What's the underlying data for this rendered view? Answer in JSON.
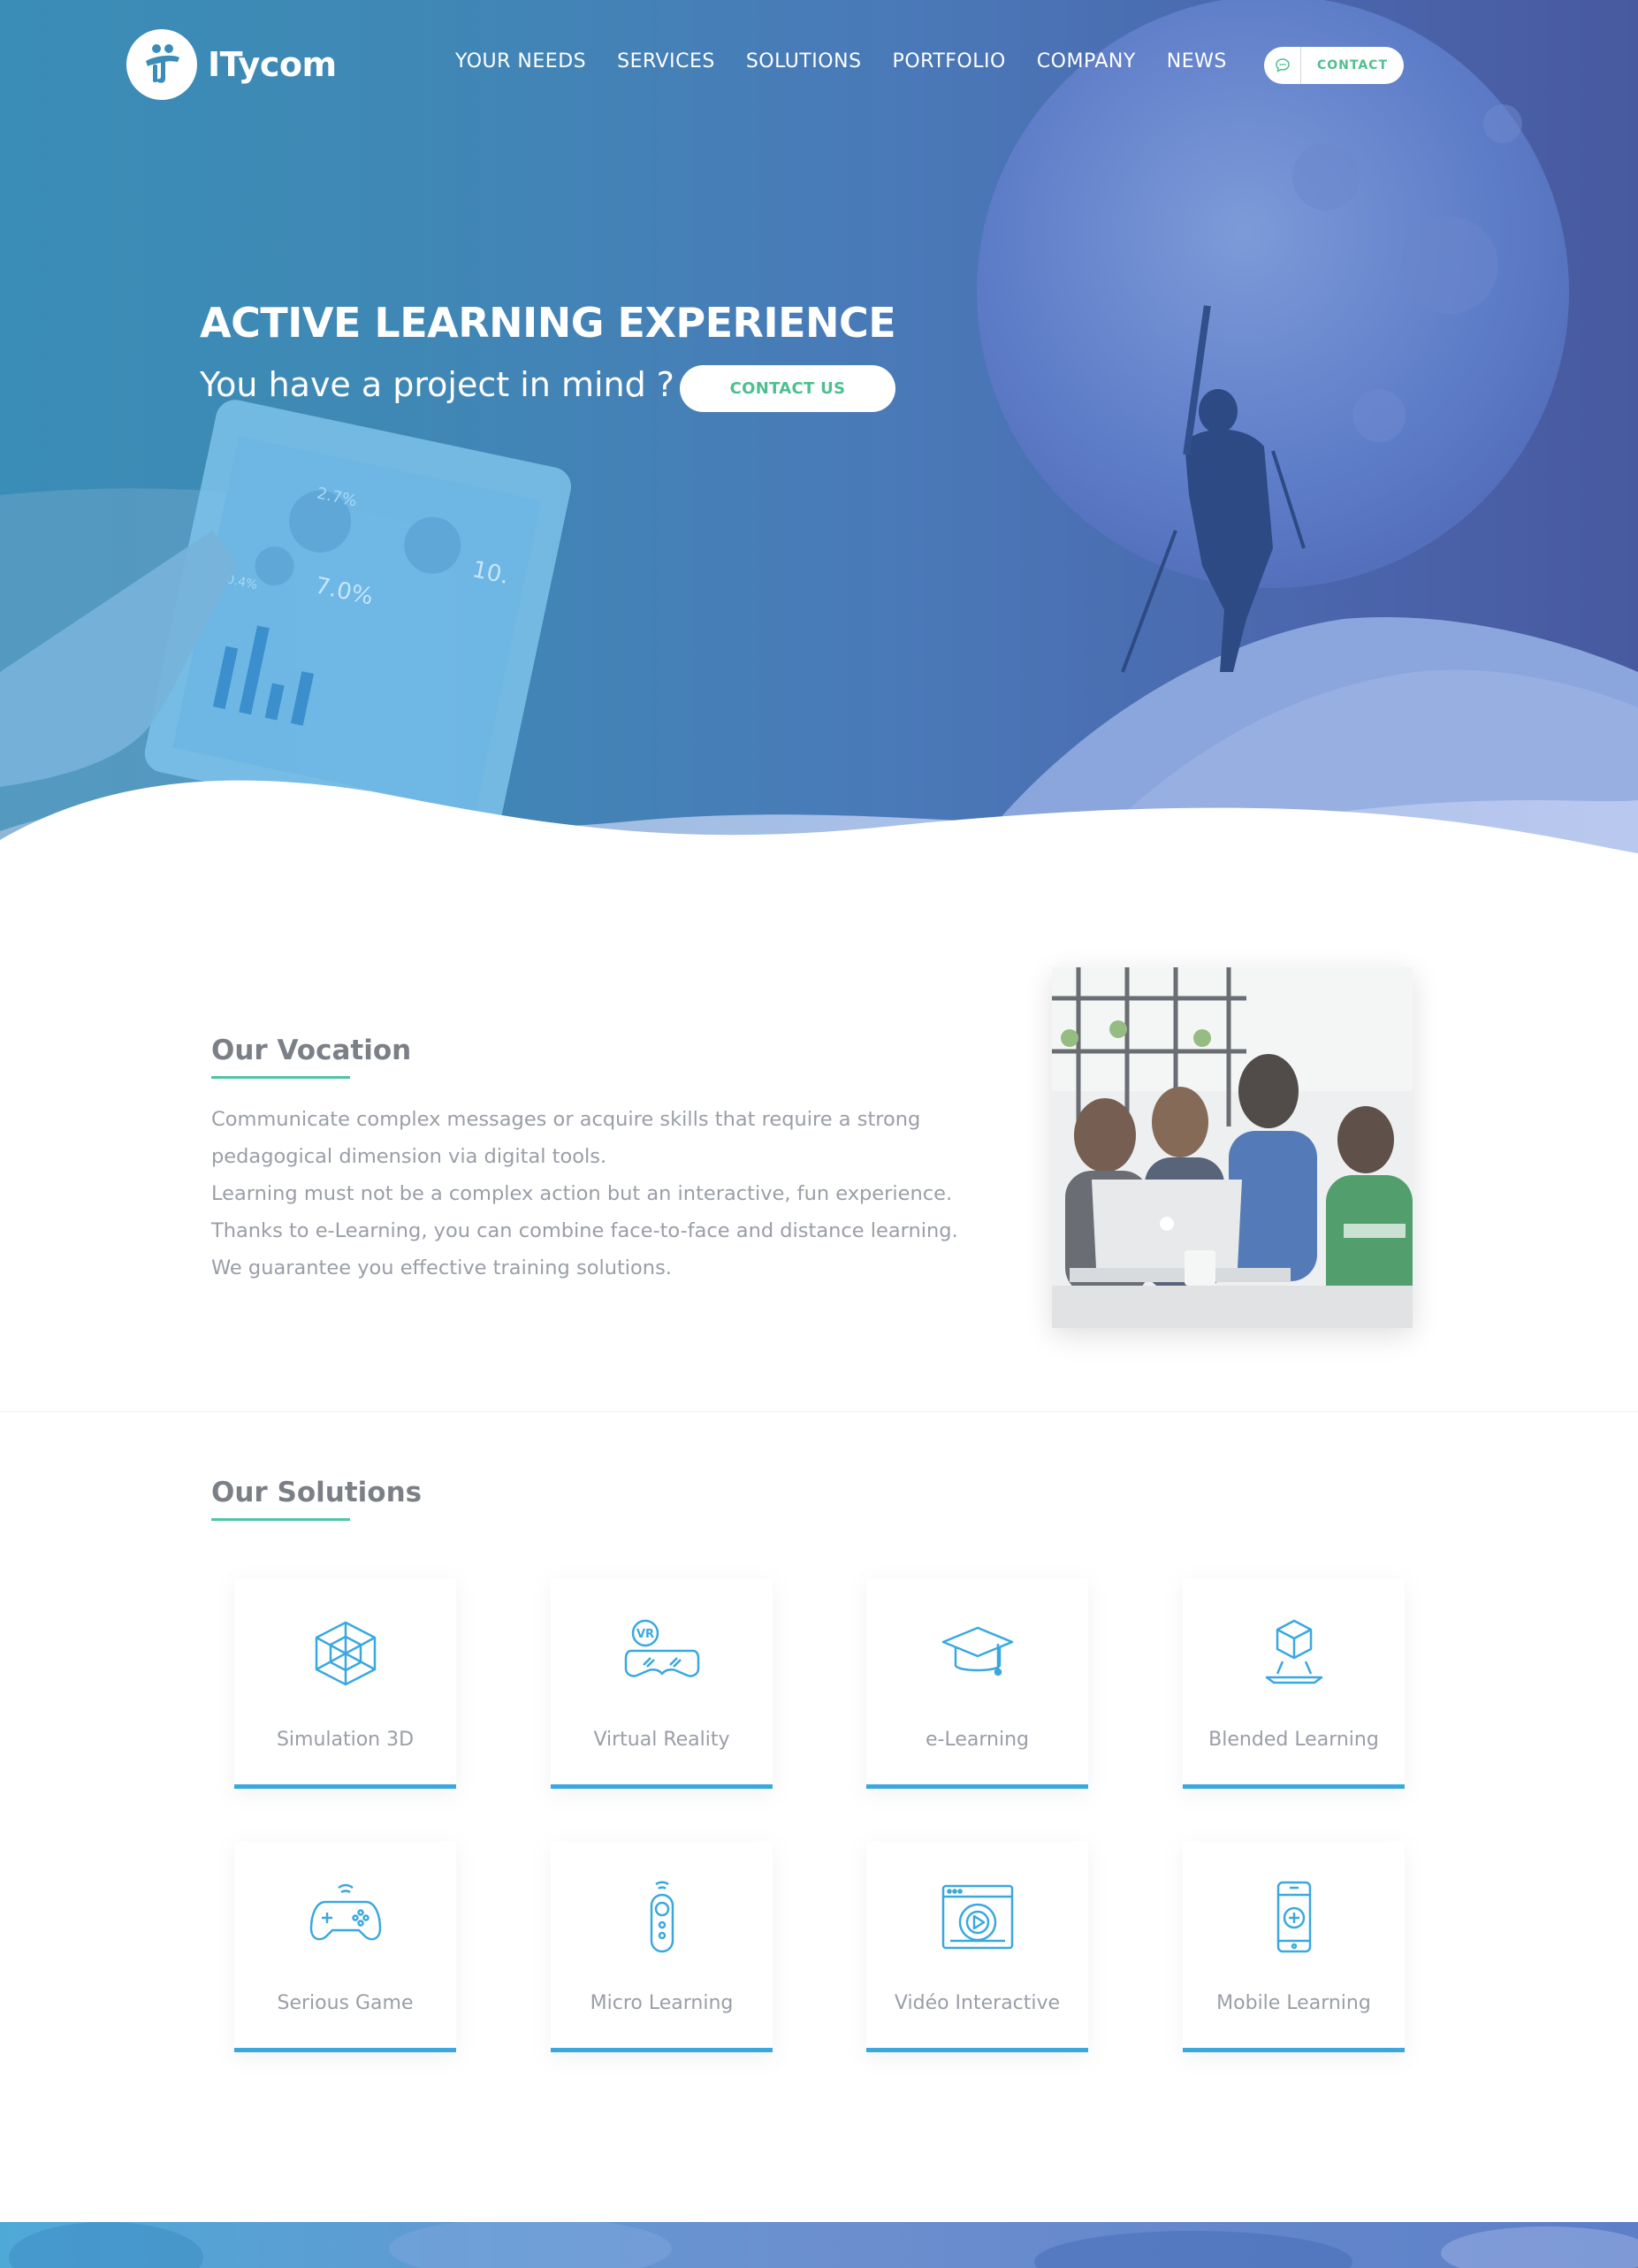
{
  "header": {
    "logo_text": "ITycom",
    "menu": [
      "YOUR NEEDS",
      "SERVICES",
      "SOLUTIONS",
      "PORTFOLIO",
      "COMPANY",
      "NEWS"
    ],
    "contact_label": "CONTACT",
    "contact_icon": "chat-bubble-icon"
  },
  "hero": {
    "title": "ACTIVE LEARNING EXPERIENCE",
    "subtitle": "You have a project in mind ?",
    "cta_label": "CONTACT US",
    "tablet_labels": [
      "2.7%",
      "10.",
      "7.0%",
      "0.4%"
    ]
  },
  "vocation": {
    "title": "Our Vocation",
    "lines": [
      "Communicate complex messages or acquire skills that require a strong",
      "pedagogical dimension via digital tools.",
      "Learning must not be a complex action but an interactive, fun experience.",
      "Thanks to e-Learning, you can combine face-to-face and distance learning.",
      "We guarantee you effective training solutions."
    ]
  },
  "solutions": {
    "title": "Our Solutions",
    "items": [
      {
        "label": "Simulation 3D",
        "icon": "cube-3d-icon"
      },
      {
        "label": "Virtual Reality",
        "icon": "vr-headset-icon"
      },
      {
        "label": "e-Learning",
        "icon": "graduation-cap-icon"
      },
      {
        "label": "Blended Learning",
        "icon": "hologram-cube-icon"
      },
      {
        "label": "Serious Game",
        "icon": "gamepad-icon"
      },
      {
        "label": "Micro Learning",
        "icon": "remote-control-icon"
      },
      {
        "label": "Vidéo Interactive",
        "icon": "video-player-icon"
      },
      {
        "label": "Mobile Learning",
        "icon": "smartphone-game-icon"
      }
    ]
  },
  "colors": {
    "accent_green": "#4fbf8f",
    "accent_blue": "#3aa8df",
    "hero_start": "#3a8db6",
    "hero_end": "#48599f"
  }
}
